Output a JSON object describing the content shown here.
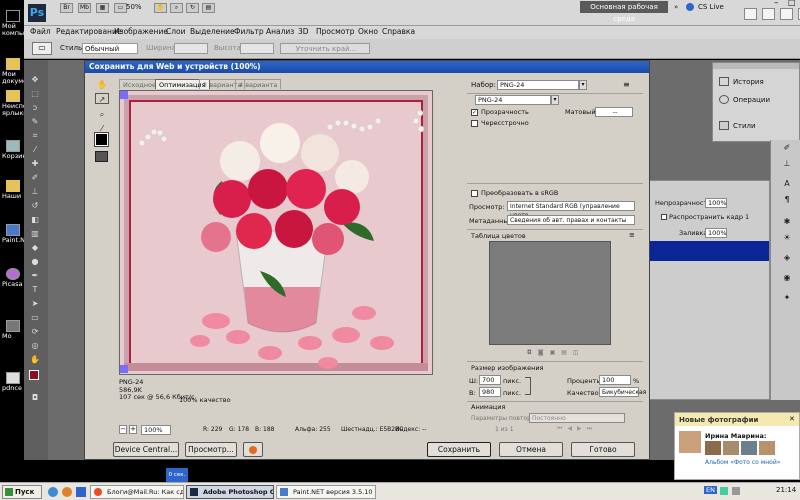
{
  "desktop": {
    "icons": [
      {
        "label": "Мой компьютер"
      },
      {
        "label": "Мои документы"
      },
      {
        "label": "Неиспользуемые ярлыки"
      },
      {
        "label": "Корзина"
      },
      {
        "label": "Наши"
      },
      {
        "label": "Paint.NET"
      },
      {
        "label": "Picasa"
      },
      {
        "label": "Мо"
      },
      {
        "label": "pdnce"
      }
    ]
  },
  "photoshop": {
    "logo": "Ps",
    "zoom": "50%",
    "workspace": "Основная рабочая среда",
    "cslive": "CS Live",
    "menu": [
      "Файл",
      "Редактирование",
      "Изображение",
      "Слои",
      "Выделение",
      "Фильтр",
      "Анализ",
      "3D",
      "Просмотр",
      "Окно",
      "Справка"
    ],
    "options": {
      "style_label": "Стиль:",
      "style_value": "Обычный",
      "width_label": "Ширина:",
      "height_label": "Высота:",
      "refine_button": "Уточнить край..."
    },
    "panels": {
      "history": "История",
      "operations": "Операции",
      "styles": "Стили"
    },
    "layers": {
      "opacity_label": "Непрозрачность:",
      "opacity_value": "100%",
      "spread_label": "Распространить кадр 1",
      "fill_label": "Заливка:",
      "fill_value": "100%"
    }
  },
  "dialog": {
    "title": "Сохранить для Web и устройств (100%)",
    "tabs": [
      "Исходное",
      "Оптимизация",
      "2 варианта",
      "4 варианта"
    ],
    "active_tab": 1,
    "preset_label": "Набор:",
    "preset_value": "PNG-24",
    "format_value": "PNG-24",
    "transparency_label": "Прозрачность",
    "transparency_checked": true,
    "interlace_label": "Чересстрочно",
    "interlace_checked": false,
    "matte_label": "Матовый:",
    "matte_value": "--",
    "convert_srgb_label": "Преобразовать в sRGB",
    "preview_label": "Просмотр:",
    "preview_value": "Internet Standard RGB (управление цвето...",
    "metadata_label": "Метаданные:",
    "metadata_value": "Сведения об авт. правах и контакты",
    "color_table_label": "Таблица цветов",
    "image_size_label": "Размер изображения",
    "w_label": "Ш:",
    "w_value": "700",
    "w_unit": "пикс.",
    "h_label": "В:",
    "h_value": "980",
    "h_unit": "пикс.",
    "percent_label": "Проценты:",
    "percent_value": "100",
    "percent_unit": "%",
    "quality_label": "Качество:",
    "quality_value": "Бикубическая",
    "animation_label": "Анимация",
    "loop_label": "Параметры повторов:",
    "loop_value": "Постоянно",
    "frame_counter": "1 из 1",
    "info_lines": [
      "PNG-24",
      "586,9K",
      "107 сек @ 56,6 Кбит/с"
    ],
    "info_side": "100% качество",
    "zoom_value": "100%",
    "status": {
      "r": "R: 229",
      "g": "G: 178",
      "b": "B: 188",
      "alpha": "Альфа: 255",
      "hex": "Шестнадц.: E5B2BC",
      "index": "Индекс: --"
    },
    "buttons": {
      "device_central": "Device Central...",
      "preview": "Просмотр...",
      "save": "Сохранить",
      "cancel": "Отмена",
      "done": "Готово"
    }
  },
  "notification": {
    "title": "Новые фотографии",
    "name": "Ирина Маврина:",
    "album": "Альбом «Фото со мной»"
  },
  "taskbar": {
    "start": "Пуск",
    "tasks": [
      "Блоги@Mail.Ru: Как сде...",
      "Adobe Photoshop CS...",
      "Paint.NET версия 3.5.10"
    ],
    "lang": "EN",
    "clock": "21:14",
    "preview_label": "0 сек."
  },
  "colors": {
    "titlebar": "#2d66c8",
    "canvas_bg": "#e8c9cd",
    "rose_red": "#d81e4a",
    "rose_white": "#f7f0ea",
    "accent_blue": "#0a2696"
  }
}
